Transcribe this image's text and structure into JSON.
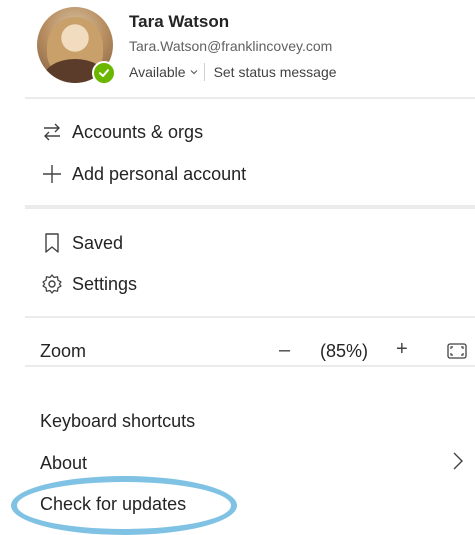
{
  "profile": {
    "name": "Tara Watson",
    "email": "Tara.Watson@franklincovey.com",
    "status": "Available",
    "status_chevron_icon": "chevron-down-icon",
    "set_status": "Set status message",
    "presence_color": "#6bb700"
  },
  "menu": {
    "accounts": {
      "label": "Accounts & orgs",
      "icon": "switch-arrows-icon"
    },
    "add_account": {
      "label": "Add personal account",
      "icon": "plus-icon"
    },
    "saved": {
      "label": "Saved",
      "icon": "bookmark-icon"
    },
    "settings": {
      "label": "Settings",
      "icon": "gear-icon"
    }
  },
  "zoom": {
    "label": "Zoom",
    "minus": "–",
    "value": "(85%)",
    "plus": "+",
    "fit_icon": "fit-to-window-icon"
  },
  "footer": {
    "keyboard_shortcuts": "Keyboard shortcuts",
    "about": "About",
    "about_icon": "chevron-right-icon",
    "check_updates": "Check for updates"
  },
  "annotation": {
    "highlight_color": "#80c2e4"
  }
}
